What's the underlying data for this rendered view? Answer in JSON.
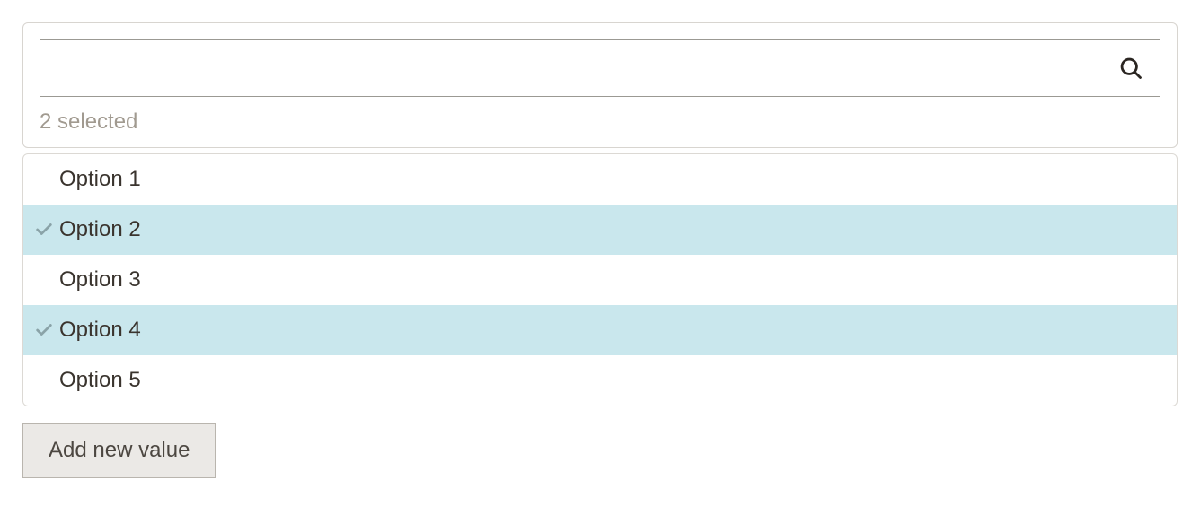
{
  "search": {
    "value": "",
    "placeholder": ""
  },
  "selected_count_text": "2 selected",
  "options": [
    {
      "label": "Option 1",
      "selected": false
    },
    {
      "label": "Option 2",
      "selected": true
    },
    {
      "label": "Option 3",
      "selected": false
    },
    {
      "label": "Option 4",
      "selected": true
    },
    {
      "label": "Option 5",
      "selected": false
    }
  ],
  "add_button_label": "Add new value"
}
